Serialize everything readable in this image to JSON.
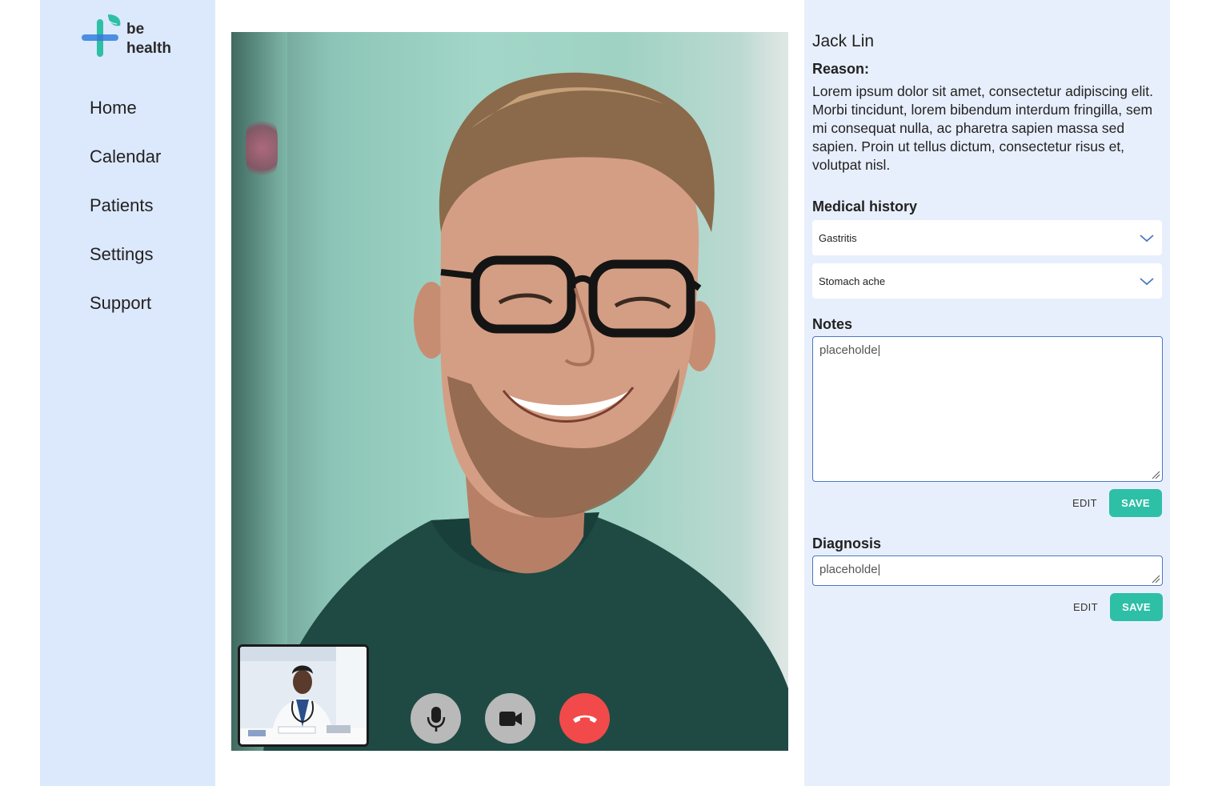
{
  "brand": {
    "name_line1": "be",
    "name_line2": "health",
    "cross_color": "#4a90e2",
    "leaf_color": "#2ebfa7"
  },
  "sidebar": {
    "items": [
      {
        "label": "Home"
      },
      {
        "label": "Calendar"
      },
      {
        "label": "Patients"
      },
      {
        "label": "Settings"
      },
      {
        "label": "Support"
      }
    ]
  },
  "call": {
    "controls": [
      {
        "icon": "microphone-icon"
      },
      {
        "icon": "video-camera-icon"
      },
      {
        "icon": "end-call-icon",
        "color": "#f24a4a"
      }
    ]
  },
  "patient": {
    "name": "Jack Lin",
    "reason_label": "Reason:",
    "reason_text": "Lorem ipsum dolor sit amet, consectetur adipiscing elit. Morbi tincidunt, lorem bibendum interdum fringilla, sem mi consequat nulla, ac pharetra sapien massa sed sapien. Proin ut tellus dictum, consectetur risus et, volutpat nisl."
  },
  "medical_history": {
    "label": "Medical history",
    "items": [
      {
        "value": "Gastritis"
      },
      {
        "value": "Stomach ache"
      }
    ]
  },
  "notes": {
    "label": "Notes",
    "value": "placeholde|",
    "edit_label": "EDIT",
    "save_label": "SAVE"
  },
  "diagnosis": {
    "label": "Diagnosis",
    "value": "placeholde|",
    "edit_label": "EDIT",
    "save_label": "SAVE"
  },
  "colors": {
    "sidebar_bg": "#dce8fc",
    "panel_bg": "#e8effc",
    "accent": "#2ebfa7",
    "end_call": "#f24a4a"
  }
}
